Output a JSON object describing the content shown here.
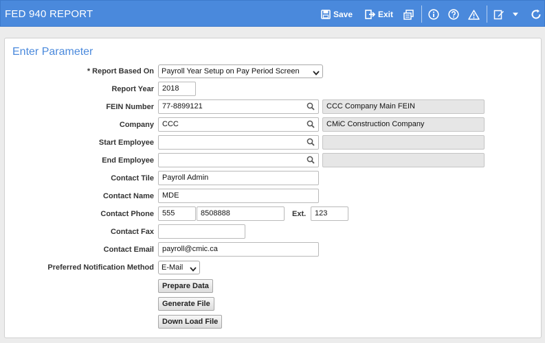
{
  "window": {
    "title": "FED 940 REPORT",
    "accent_color": "#4a89dc"
  },
  "toolbar": {
    "save_label": "Save",
    "exit_label": "Exit",
    "icons": [
      "save-icon",
      "exit-icon",
      "print-icon",
      "info-icon",
      "help-icon",
      "warning-icon",
      "edit-icon",
      "dropdown-icon",
      "refresh-icon"
    ]
  },
  "panel": {
    "title": "Enter Parameter"
  },
  "form": {
    "report_based_on": {
      "label": "* Report Based On",
      "value": "Payroll Year Setup on Pay Period Screen"
    },
    "report_year": {
      "label": "Report Year",
      "value": "2018"
    },
    "fein_number": {
      "label": "FEIN Number",
      "value": "77-8899121",
      "description": "CCC Company Main FEIN"
    },
    "company": {
      "label": "Company",
      "value": "CCC",
      "description": "CMiC Construction Company"
    },
    "start_employee": {
      "label": "Start Employee",
      "value": "",
      "description": ""
    },
    "end_employee": {
      "label": "End Employee",
      "value": "",
      "description": ""
    },
    "contact_title": {
      "label": "Contact Tile",
      "value": "Payroll Admin"
    },
    "contact_name": {
      "label": "Contact Name",
      "value": "MDE"
    },
    "contact_phone": {
      "label": "Contact Phone",
      "area_code": "555",
      "number": "8508888",
      "ext_label": "Ext.",
      "ext": "123"
    },
    "contact_fax": {
      "label": "Contact Fax",
      "value": ""
    },
    "contact_email": {
      "label": "Contact Email",
      "value": "payroll@cmic.ca"
    },
    "notification_method": {
      "label": "Preferred Notification Method",
      "value": "E-Mail"
    }
  },
  "actions": {
    "prepare_data": "Prepare Data",
    "generate_file": "Generate File",
    "download_file": "Down Load File"
  }
}
